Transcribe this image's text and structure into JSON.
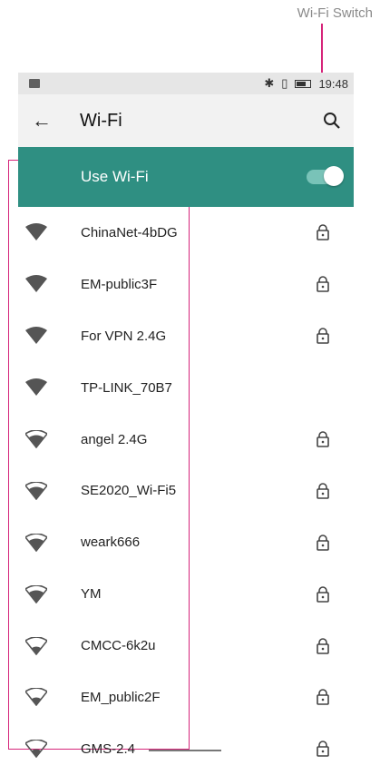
{
  "annotation": {
    "label": "Wi-Fi Switch"
  },
  "status_bar": {
    "time": "19:48"
  },
  "toolbar": {
    "title": "Wi-Fi"
  },
  "use_wifi": {
    "label": "Use Wi-Fi",
    "enabled": true,
    "accent": "#2f8f82"
  },
  "networks": [
    {
      "ssid": "ChinaNet-4bDG",
      "locked": true,
      "strength": "full"
    },
    {
      "ssid": "EM-public3F",
      "locked": true,
      "strength": "full"
    },
    {
      "ssid": "For VPN 2.4G",
      "locked": true,
      "strength": "full"
    },
    {
      "ssid": "TP-LINK_70B7",
      "locked": false,
      "strength": "full"
    },
    {
      "ssid": "angel 2.4G",
      "locked": true,
      "strength": "partial"
    },
    {
      "ssid": "SE2020_Wi-Fi5",
      "locked": true,
      "strength": "partial"
    },
    {
      "ssid": "weark666",
      "locked": true,
      "strength": "partial"
    },
    {
      "ssid": "YM",
      "locked": true,
      "strength": "partial"
    },
    {
      "ssid": "CMCC-6k2u",
      "locked": true,
      "strength": "weak"
    },
    {
      "ssid": "EM_public2F",
      "locked": true,
      "strength": "weak"
    },
    {
      "ssid": "GMS-2.4",
      "locked": true,
      "strength": "weak"
    }
  ]
}
